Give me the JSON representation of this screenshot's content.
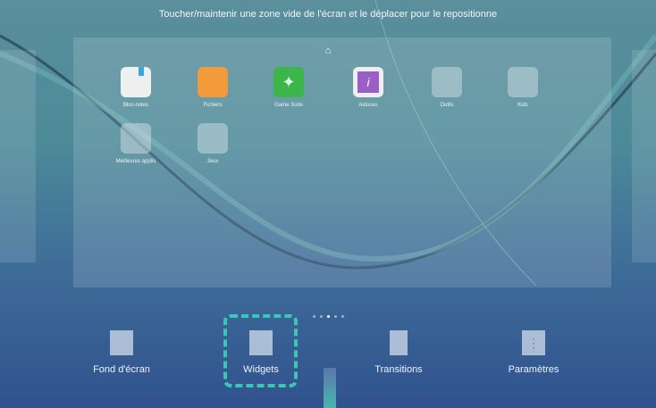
{
  "hint": "Toucher/maintenir une zone vide de l'écran et le déplacer pour le repositionne",
  "apps": [
    {
      "label": "Bloc-notes",
      "color": "#eef0f0"
    },
    {
      "label": "Fichiers",
      "color": "#f39a3a"
    },
    {
      "label": "Game Suite",
      "color": "#3cb54a"
    },
    {
      "label": "Astuces",
      "color": "#9a5fc4"
    },
    {
      "label": "Outils",
      "color": "folder"
    },
    {
      "label": "Kids",
      "color": "folder"
    },
    {
      "label": "Meilleures applis",
      "color": "folder"
    },
    {
      "label": "Jeux",
      "color": "folder"
    }
  ],
  "page_indicator": {
    "total": 5,
    "current": 3
  },
  "bottom": {
    "wallpaper": "Fond d'écran",
    "widgets": "Widgets",
    "transitions": "Transitions",
    "settings": "Paramètres"
  },
  "highlight_color": "#3ec7b0"
}
